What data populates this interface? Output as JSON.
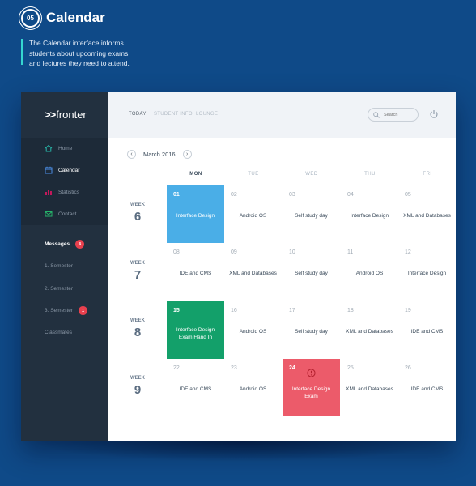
{
  "hero": {
    "badge": "05",
    "title": "Calendar",
    "description": "The Calendar interface informs students about upcoming exams and lectures they need to attend."
  },
  "app": {
    "logo_arrows": ">>",
    "logo_text": "fronter",
    "nav": [
      {
        "label": "Home",
        "icon": "home-icon"
      },
      {
        "label": "Calendar",
        "icon": "calendar-icon"
      },
      {
        "label": "Statistics",
        "icon": "statistics-icon"
      },
      {
        "label": "Contact",
        "icon": "mail-icon"
      }
    ],
    "secondary": [
      {
        "label": "Messages",
        "count": "4"
      },
      {
        "label": "1. Semester"
      },
      {
        "label": "2. Semester"
      },
      {
        "label": "3. Semester",
        "count": "1"
      },
      {
        "label": "Classmates"
      }
    ],
    "tabs": [
      "TODAY",
      "STUDENT INFO",
      "LOUNGE"
    ],
    "search_placeholder": "Search",
    "month": "March 2016",
    "prev": "‹",
    "next": "›",
    "days": [
      "MON",
      "TUE",
      "WED",
      "THU",
      "FRI"
    ],
    "week_word": "WEEK",
    "weeks": [
      {
        "number": "6",
        "cells": [
          {
            "date": "01",
            "event": "Interface Design",
            "style": "blue"
          },
          {
            "date": "02",
            "event": "Android OS"
          },
          {
            "date": "03",
            "event": "Self study day"
          },
          {
            "date": "04",
            "event": "Interface Design"
          },
          {
            "date": "05",
            "event": "XML and Databases"
          }
        ]
      },
      {
        "number": "7",
        "cells": [
          {
            "date": "08",
            "event": "IDE and CMS"
          },
          {
            "date": "09",
            "event": "XML and Databases"
          },
          {
            "date": "10",
            "event": "Self study day"
          },
          {
            "date": "11",
            "event": "Android OS"
          },
          {
            "date": "12",
            "event": "Interface Design"
          }
        ]
      },
      {
        "number": "8",
        "cells": [
          {
            "date": "15",
            "event": "Interface Design Exam Hand In",
            "style": "green"
          },
          {
            "date": "16",
            "event": "Android OS"
          },
          {
            "date": "17",
            "event": "Self study day"
          },
          {
            "date": "18",
            "event": "XML and Databases"
          },
          {
            "date": "19",
            "event": "IDE and CMS"
          }
        ]
      },
      {
        "number": "9",
        "cells": [
          {
            "date": "22",
            "event": "IDE and CMS"
          },
          {
            "date": "23",
            "event": "Android OS"
          },
          {
            "date": "24",
            "event": "Interface Design Exam",
            "style": "red",
            "alert": true
          },
          {
            "date": "25",
            "event": "XML and Databases"
          },
          {
            "date": "26",
            "event": "IDE and CMS"
          }
        ]
      }
    ],
    "colors": {
      "background": "#0f4a88",
      "sidebar": "#22303f",
      "blue_event": "#4aaee7",
      "green_event": "#13a06a",
      "red_event": "#ec5b6a",
      "accent_line": "#35d6d0"
    }
  }
}
